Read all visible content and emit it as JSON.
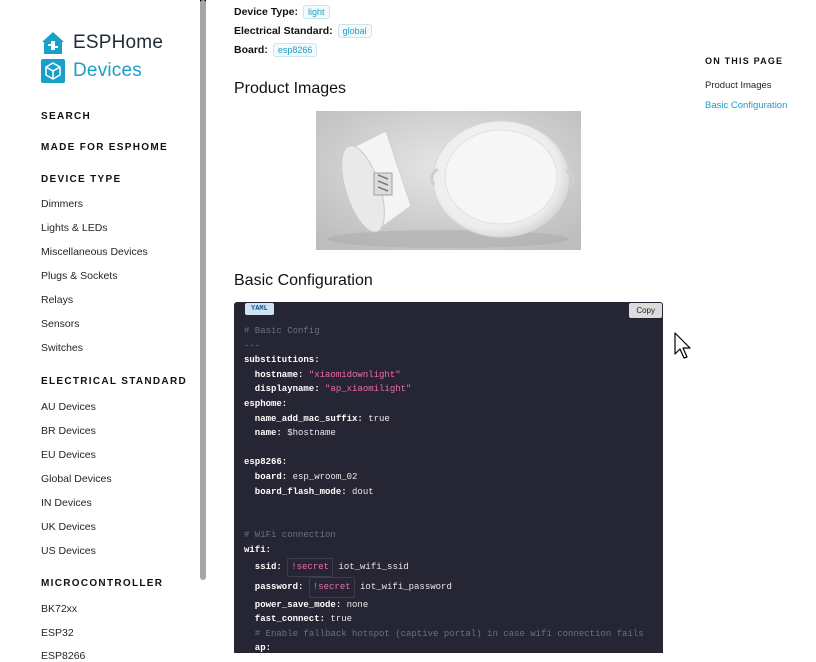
{
  "sidebar": {
    "brand_line1": "ESPHome",
    "brand_line2": "Devices",
    "search": "SEARCH",
    "made_for": "MADE FOR ESPHOME",
    "device_type_heading": "DEVICE TYPE",
    "device_types": [
      "Dimmers",
      "Lights & LEDs",
      "Miscellaneous Devices",
      "Plugs & Sockets",
      "Relays",
      "Sensors",
      "Switches"
    ],
    "electrical_heading": "ELECTRICAL STANDARD",
    "electrical": [
      "AU Devices",
      "BR Devices",
      "EU Devices",
      "Global Devices",
      "IN Devices",
      "UK Devices",
      "US Devices"
    ],
    "micro_heading": "MICROCONTROLLER",
    "micro": [
      "BK72xx",
      "ESP32",
      "ESP8266"
    ]
  },
  "meta": {
    "device_type_label": "Device Type:",
    "device_type_value": "light",
    "electrical_label": "Electrical Standard:",
    "electrical_value": "global",
    "board_label": "Board:",
    "board_value": "esp8266"
  },
  "sections": {
    "product_images": "Product Images",
    "basic_config": "Basic Configuration"
  },
  "code_block": {
    "language": "YAML",
    "copy_label": "Copy",
    "lines": {
      "l1": "# Basic Config",
      "l2": "---",
      "l3k": "substitutions:",
      "l4k": "  hostname: ",
      "l4v": "\"xiaomidownlight\"",
      "l5k": "  displayname: ",
      "l5v": "\"ap_xiaomilight\"",
      "l6k": "esphome:",
      "l7k": "  name_add_mac_suffix: ",
      "l7v": "true",
      "l8k": "  name: ",
      "l8v": "$hostname",
      "l10k": "esp8266:",
      "l11k": "  board: ",
      "l11v": "esp_wroom_02",
      "l12k": "  board_flash_mode: ",
      "l12v": "dout",
      "l15": "# WiFi connection",
      "l16k": "wifi:",
      "l17k": "  ssid: ",
      "l17t": "!secret",
      "l17v": " iot_wifi_ssid",
      "l18k": "  password: ",
      "l18t": "!secret",
      "l18v": " iot_wifi_password",
      "l19k": "  power_save_mode: ",
      "l19v": "none",
      "l20k": "  fast_connect: ",
      "l20v": "true",
      "l21": "  # Enable fallback hotspot (captive portal) in case wifi connection fails",
      "l22k": "  ap:"
    }
  },
  "toc": {
    "title": "ON THIS PAGE",
    "items": [
      "Product Images",
      "Basic Configuration"
    ]
  },
  "colors": {
    "accent": "#19a0c8",
    "code_bg": "#252533",
    "string": "#f06ca8"
  }
}
